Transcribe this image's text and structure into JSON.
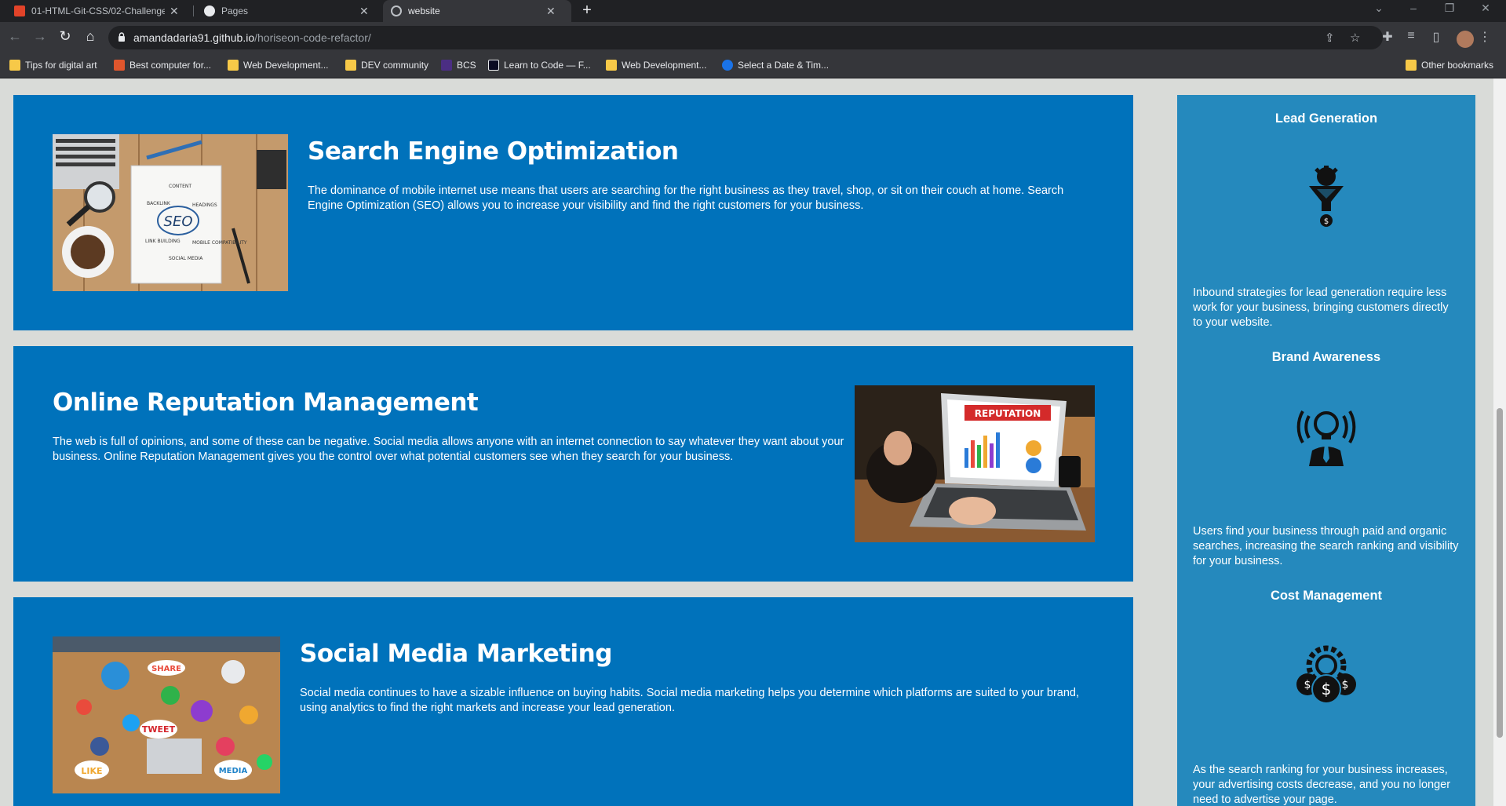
{
  "browser": {
    "tabs": [
      {
        "title": "01-HTML-Git-CSS/02-Challenge",
        "active": false
      },
      {
        "title": "Pages",
        "active": false
      },
      {
        "title": "website",
        "active": true
      }
    ],
    "url_host": "amandadaria91.github.io",
    "url_path": "/horiseon-code-refactor/",
    "bookmarks": [
      "Tips for digital art",
      "Best computer for...",
      "Web Development...",
      "DEV community",
      "BCS",
      "Learn to Code — F...",
      "Web Development...",
      "Select a Date & Tim..."
    ],
    "other_bookmarks": "Other bookmarks"
  },
  "sections": {
    "seo": {
      "title": "Search Engine Optimization",
      "text": "The dominance of mobile internet use means that users are searching for the right business as they travel, shop, or sit on their couch at home. Search Engine Optimization (SEO) allows you to increase your visibility and find the right customers for your business.",
      "img_words": [
        "CONTENT",
        "BACKLINK",
        "HEADINGS",
        "SEO",
        "LINK BUILDING",
        "MOBILE COMPATIBILITY",
        "SOCIAL MEDIA"
      ]
    },
    "orm": {
      "title": "Online Reputation Management",
      "text": "The web is full of opinions, and some of these can be negative. Social media allows anyone with an internet connection to say whatever they want about your business. Online Reputation Management gives you the control over what potential customers see when they search for your business.",
      "img_words": [
        "REPUTATION"
      ]
    },
    "smm": {
      "title": "Social Media Marketing",
      "text": "Social media continues to have a sizable influence on buying habits. Social media marketing helps you determine which platforms are suited to your brand, using analytics to find the right markets and increase your lead generation.",
      "img_words": [
        "SHARE",
        "TWEET",
        "LIKE",
        "MEDIA"
      ]
    }
  },
  "benefits": {
    "lead": {
      "title": "Lead Generation",
      "text": "Inbound strategies for lead generation require less work for your business, bringing customers directly to your website."
    },
    "brand": {
      "title": "Brand Awareness",
      "text": "Users find your business through paid and organic searches, increasing the search ranking and visibility for your business."
    },
    "cost": {
      "title": "Cost Management",
      "text": "As the search ranking for your business increases, your advertising costs decrease, and you no longer need to advertise your page."
    }
  },
  "colors": {
    "card_bg": "#0072bb",
    "aside_bg": "#2589bd",
    "page_bg": "#d9dbd8"
  }
}
